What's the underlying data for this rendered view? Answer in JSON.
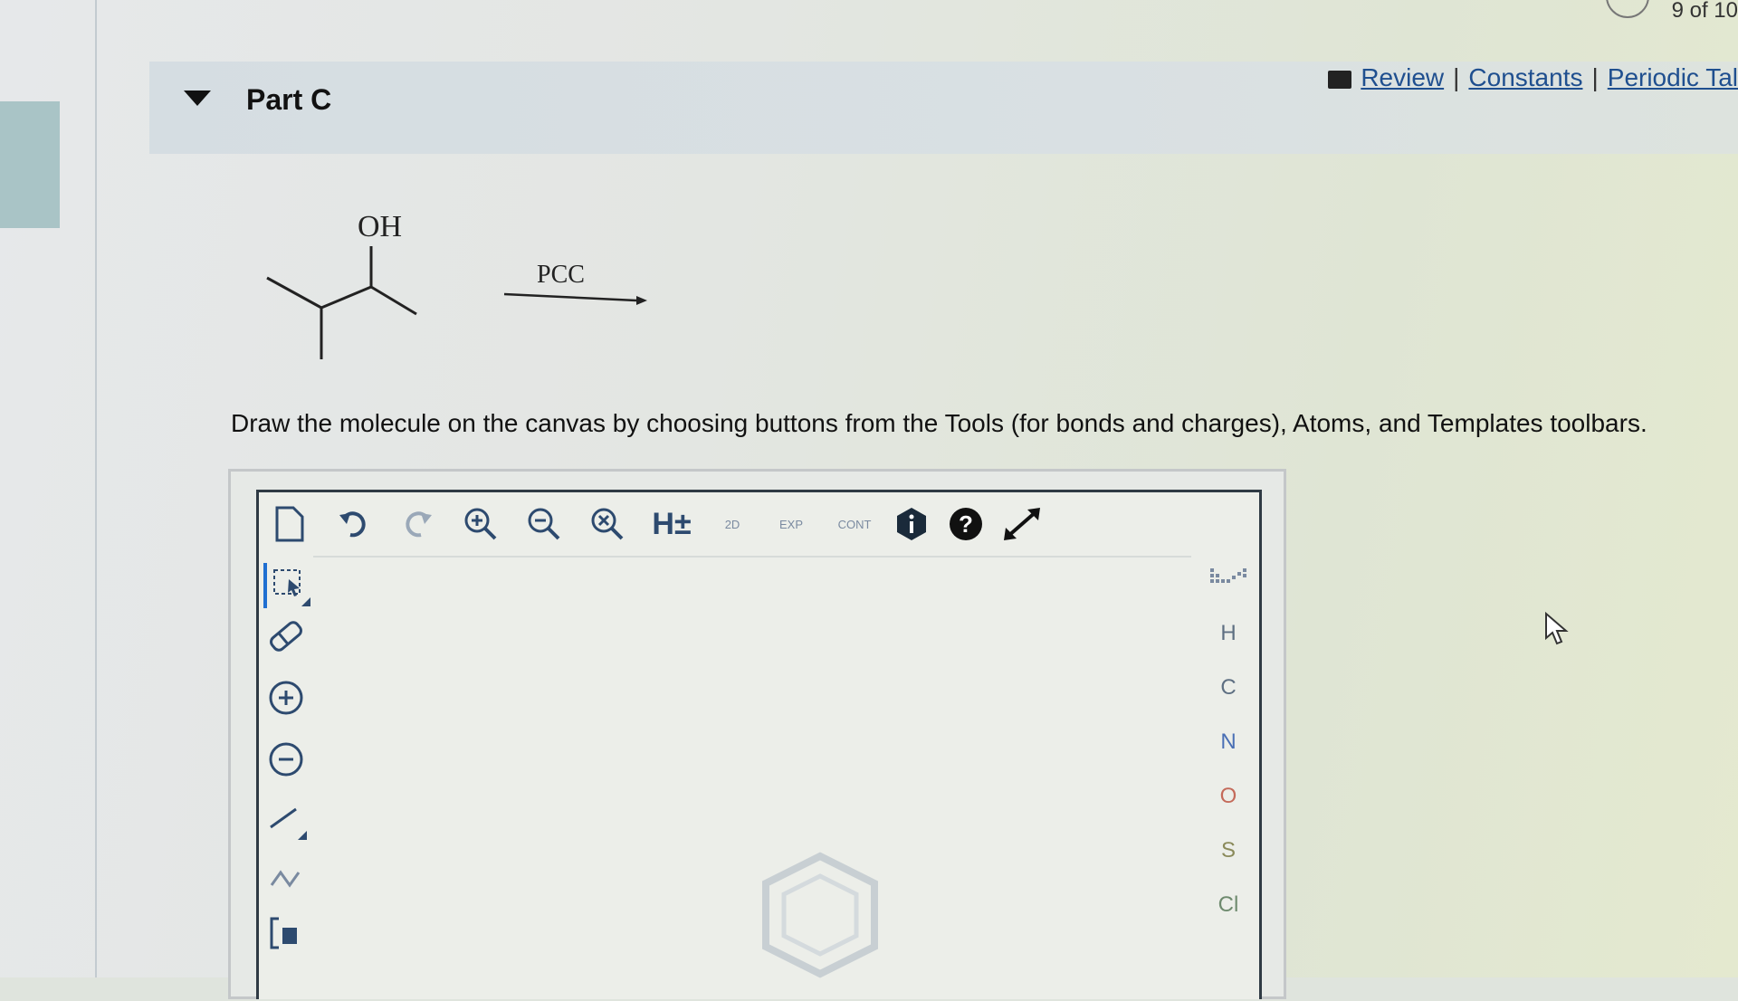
{
  "counter": "9 of 10",
  "part": {
    "title": "Part C"
  },
  "links": {
    "review": "Review",
    "constants": "Constants",
    "periodic": "Periodic Tal",
    "separator": "|"
  },
  "reaction": {
    "substituent": "OH",
    "reagent": "PCC"
  },
  "instruction": "Draw the molecule on the canvas by choosing buttons from the Tools (for bonds and charges), Atoms, and Templates toolbars.",
  "toolbar": {
    "hydrogen": "H±",
    "view_2d": "2D",
    "expand": "EXP",
    "contract": "CONT"
  },
  "atoms": [
    "H",
    "C",
    "N",
    "O",
    "S",
    "Cl"
  ],
  "colors": {
    "link": "#1f4f8f",
    "icon": "#2d4a6f",
    "header_bg": "#d7dee2"
  }
}
